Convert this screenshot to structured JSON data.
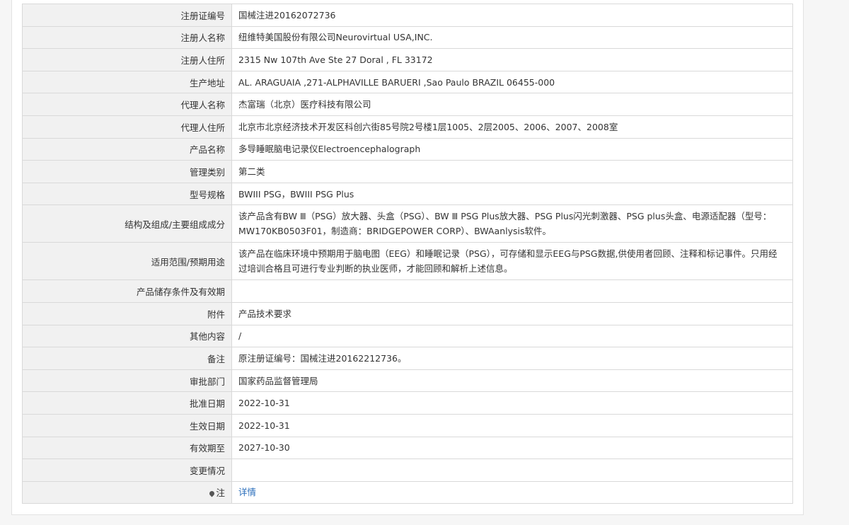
{
  "rows": [
    {
      "label": "注册证编号",
      "value": "国械注进20162072736"
    },
    {
      "label": "注册人名称",
      "value": "纽维特美国股份有限公司Neurovirtual USA,INC."
    },
    {
      "label": "注册人住所",
      "value": "2315 Nw 107th Ave Ste 27 Doral , FL 33172"
    },
    {
      "label": "生产地址",
      "value": "AL. ARAGUAIA ,271-ALPHAVILLE BARUERI ,Sao Paulo BRAZIL 06455-000"
    },
    {
      "label": "代理人名称",
      "value": "杰富瑞（北京）医疗科技有限公司"
    },
    {
      "label": "代理人住所",
      "value": "北京市北京经济技术开发区科创六街85号院2号楼1层1005、2层2005、2006、2007、2008室"
    },
    {
      "label": "产品名称",
      "value": "多导睡眠脑电记录仪Electroencephalograph"
    },
    {
      "label": "管理类别",
      "value": "第二类"
    },
    {
      "label": "型号规格",
      "value": "BWIII PSG，BWIII PSG Plus"
    },
    {
      "label": "结构及组成/主要组成成分",
      "value": "该产品含有BW Ⅲ（PSG）放大器、头盒（PSG）、BW Ⅲ PSG Plus放大器、PSG Plus闪光刺激器、PSG plus头盒、电源适配器（型号：MW170KB0503F01，制造商：BRIDGEPOWER CORP）、BWAanlysis软件。"
    },
    {
      "label": "适用范围/预期用途",
      "value": "该产品在临床环境中预期用于脑电图（EEG）和睡眠记录（PSG），可存储和显示EEG与PSG数据,供使用者回顾、注释和标记事件。只用经过培训合格且可进行专业判断的执业医师，才能回顾和解析上述信息。"
    },
    {
      "label": "产品储存条件及有效期",
      "value": ""
    },
    {
      "label": "附件",
      "value": "产品技术要求"
    },
    {
      "label": "其他内容",
      "value": "/"
    },
    {
      "label": "备注",
      "value": "原注册证编号：国械注进20162212736。"
    },
    {
      "label": "审批部门",
      "value": "国家药品监督管理局"
    },
    {
      "label": "批准日期",
      "value": "2022-10-31"
    },
    {
      "label": "生效日期",
      "value": "2022-10-31"
    },
    {
      "label": "有效期至",
      "value": "2027-10-30"
    },
    {
      "label": "变更情况",
      "value": ""
    }
  ],
  "note": {
    "label": "注",
    "link_text": "详情",
    "icon": "map-pin-icon"
  }
}
